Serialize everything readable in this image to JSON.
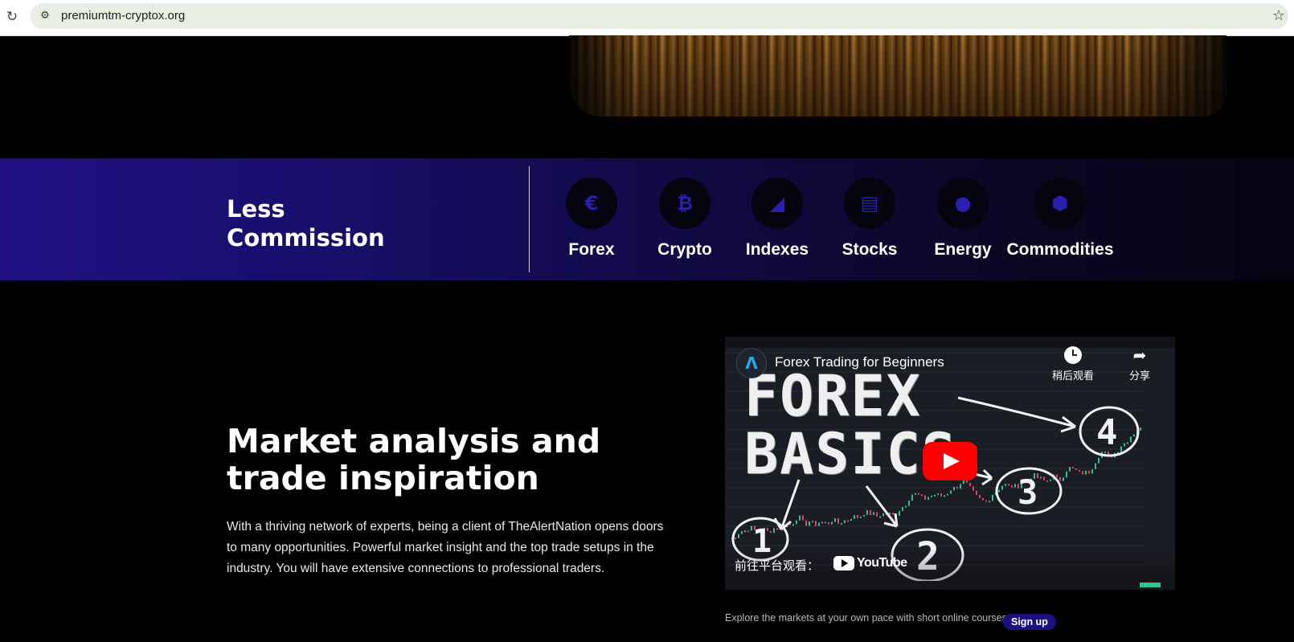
{
  "browser": {
    "url": "premiumtm-cryptox.org",
    "reload_icon": "reload-icon",
    "site_info_icon": "site-info-icon",
    "bookmark_icon": "star-icon"
  },
  "band": {
    "title": "Less Commission",
    "categories": [
      {
        "label": "Forex",
        "icon": "euro-icon",
        "glyph": "€"
      },
      {
        "label": "Crypto",
        "icon": "bitcoin-icon",
        "glyph": "₿"
      },
      {
        "label": "Indexes",
        "icon": "area-chart-icon",
        "glyph": "◢"
      },
      {
        "label": "Stocks",
        "icon": "document-chart-icon",
        "glyph": "▤"
      },
      {
        "label": "Energy",
        "icon": "droplet-icon",
        "glyph": "●"
      },
      {
        "label": "Commodities",
        "icon": "box-icon",
        "glyph": "⬢"
      }
    ]
  },
  "market": {
    "title": "Market analysis and trade inspiration",
    "text": "With a thriving network of experts, being a client of TheAlertNation opens doors to many opportunities. Powerful market insight and the top trade setups in the industry. You will have extensive connections to professional traders."
  },
  "video": {
    "title": "Forex Trading for Beginners",
    "channel_glyph": "Λ",
    "watch_later": "稍后观看",
    "share": "分享",
    "thumbnail_text": "FOREX BASICS",
    "watch_on": "前往平台观看：",
    "youtube": "YouTube",
    "numbers": [
      "1",
      "2",
      "3",
      "4"
    ],
    "colors": {
      "play": "#ff0000",
      "up": "#2ec28e",
      "down": "#e8425a"
    }
  },
  "courses": {
    "text": "Explore the markets at your own pace with short online courses.",
    "signup": "Sign up"
  }
}
